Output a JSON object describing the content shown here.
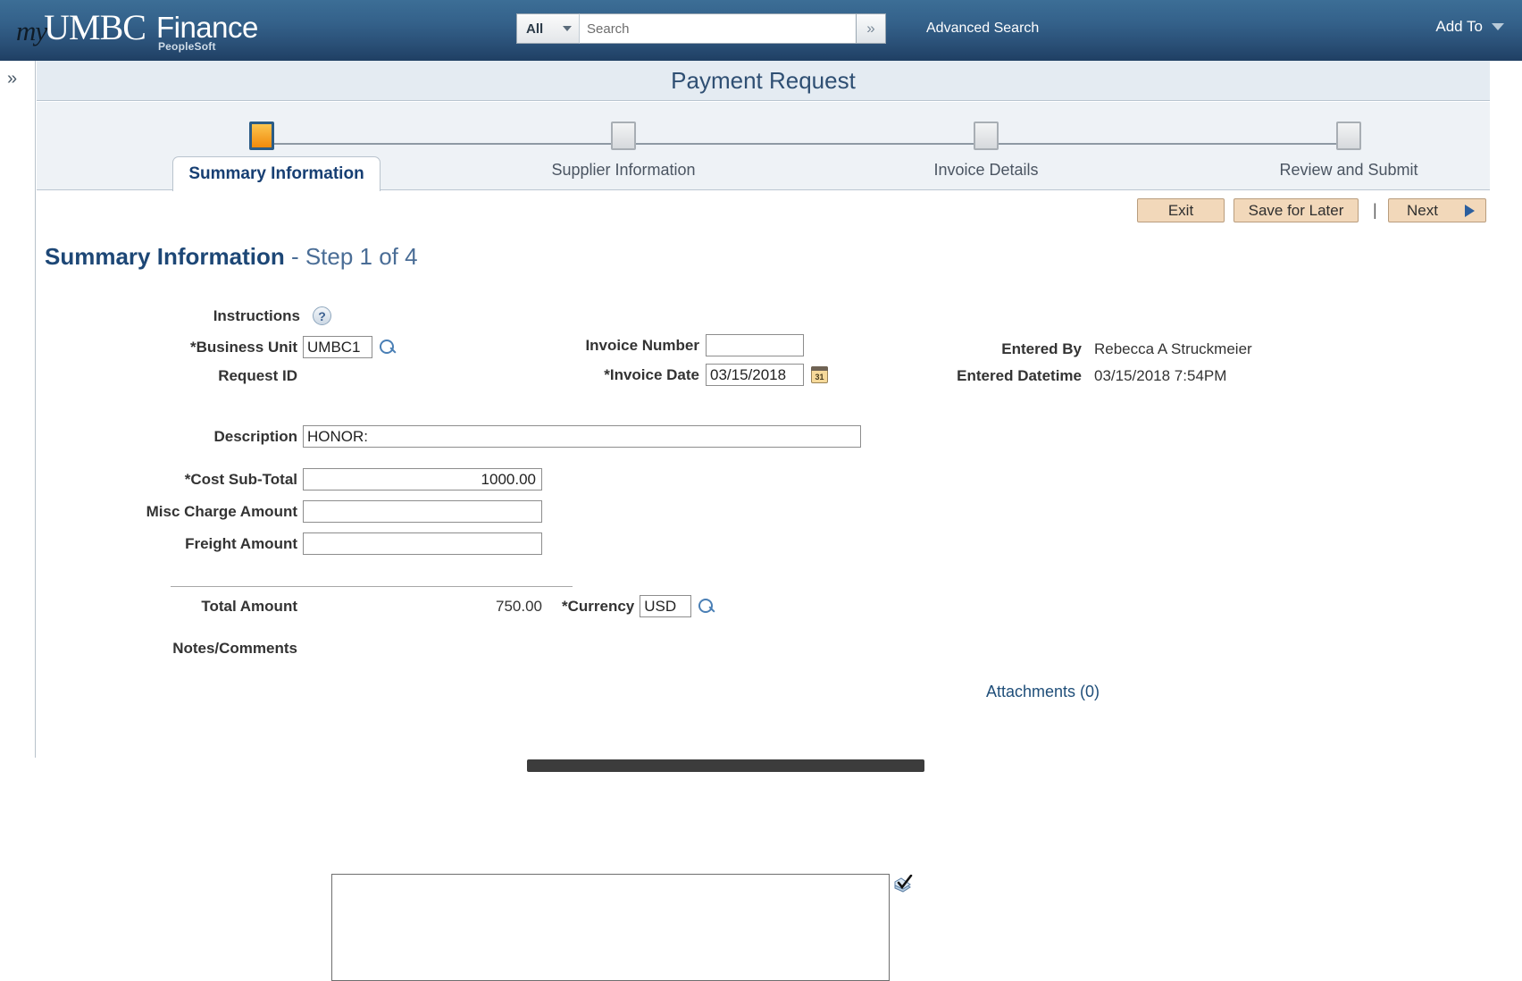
{
  "brand": {
    "my": "my",
    "umbc": "UMBC",
    "finance": "Finance",
    "peoplesoft": "PeopleSoft"
  },
  "header": {
    "search_category": "All",
    "search_placeholder": "Search",
    "search_value": "",
    "search_go_icon": "double-chevron-right-icon",
    "advanced_search": "Advanced Search",
    "add_to": "Add To",
    "add_to_caret_icon": "chevron-down-icon",
    "category_caret_icon": "chevron-down-icon"
  },
  "rail": {
    "expand_icon": "double-chevron-right-icon",
    "expand_glyph": "»"
  },
  "page": {
    "title": "Payment Request"
  },
  "wizard": {
    "steps": [
      {
        "label": "Summary Information",
        "active": true
      },
      {
        "label": "Supplier Information",
        "active": false
      },
      {
        "label": "Invoice Details",
        "active": false
      },
      {
        "label": "Review and Submit",
        "active": false
      }
    ]
  },
  "toolbar": {
    "exit_label": "Exit",
    "save_label": "Save for Later",
    "next_label": "Next",
    "separator": "|",
    "next_arrow_icon": "triangle-right-icon"
  },
  "section": {
    "title_bold": "Summary Information",
    "title_rest": " - Step 1 of 4"
  },
  "form": {
    "instructions_label": "Instructions",
    "help_icon": "question-mark-icon",
    "help_glyph": "?",
    "business_unit_label": "*Business Unit",
    "business_unit_value": "UMBC1",
    "business_unit_lookup_icon": "magnifier-icon",
    "request_id_label": "Request ID",
    "request_id_value": "",
    "invoice_number_label": "Invoice Number",
    "invoice_number_value": "",
    "invoice_date_label": "*Invoice Date",
    "invoice_date_value": "03/15/2018",
    "calendar_icon": "calendar-icon",
    "calendar_glyph": "31",
    "description_label": "Description",
    "description_value": "HONOR:",
    "cost_subtotal_label": "*Cost Sub-Total",
    "cost_subtotal_value": "1000.00",
    "misc_charge_label": "Misc Charge Amount",
    "misc_charge_value": "",
    "freight_label": "Freight Amount",
    "freight_value": "",
    "total_amount_label": "Total Amount",
    "total_amount_value": "750.00",
    "currency_label": "*Currency",
    "currency_value": "USD",
    "currency_lookup_icon": "magnifier-icon",
    "notes_label": "Notes/Comments",
    "notes_value": "",
    "spellcheck_icon": "spell-check-icon"
  },
  "sidepanel": {
    "entered_by_label": "Entered By",
    "entered_by_value": "Rebecca A Struckmeier",
    "entered_datetime_label": "Entered Datetime",
    "entered_datetime_value": "03/15/2018  7:54PM",
    "attachments_label": "Attachments (0)"
  },
  "colors": {
    "brand_blue": "#2a5077",
    "accent_orange": "#f08a0c",
    "button_tan": "#f2d8ba",
    "link_blue": "#1f4e79",
    "title_blue": "#2f4f73"
  }
}
